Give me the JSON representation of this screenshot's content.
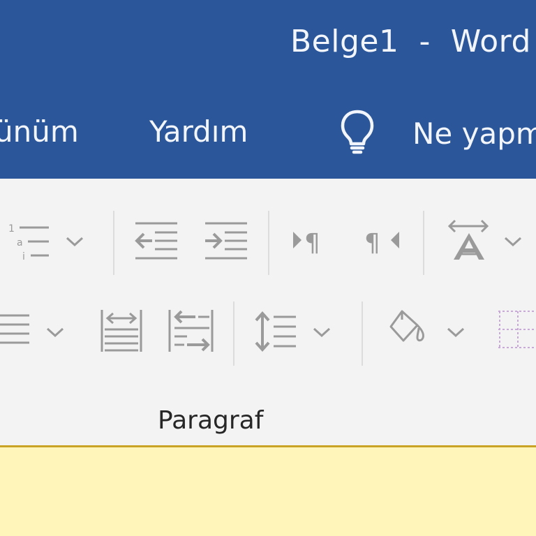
{
  "window": {
    "title": "Belge1  -  Word"
  },
  "tabs": {
    "view_label": "ünüm",
    "help_label": "Yardım",
    "tell_me_label": "Ne yapm"
  },
  "ribbon": {
    "paragraph_group_label": "Paragraf"
  },
  "colors": {
    "title_bar": "#2b579a",
    "ribbon_bg": "#f3f3f3",
    "icon_gray": "#9a9a9a",
    "info_bar": "#fff4b9",
    "info_bar_border": "#c9a326"
  },
  "icons": [
    "multilevel-list-icon",
    "decrease-indent-icon",
    "increase-indent-icon",
    "ltr-text-direction-icon",
    "rtl-text-direction-icon",
    "sort-icon",
    "justify-icon",
    "distributed-icon",
    "indent-arrows-icon",
    "line-spacing-icon",
    "shading-icon",
    "borders-icon",
    "lightbulb-icon"
  ]
}
